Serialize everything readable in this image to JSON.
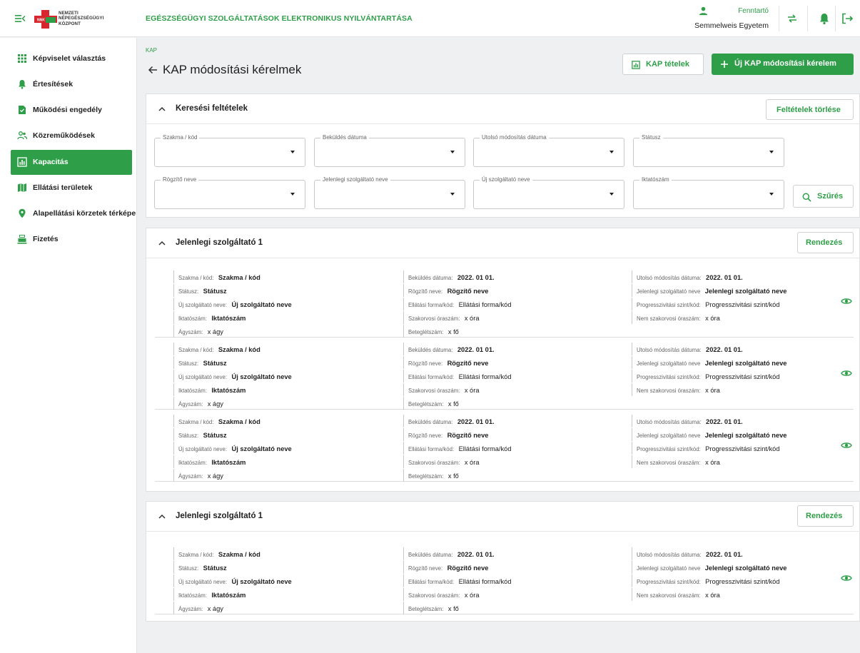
{
  "header": {
    "logo_lines": [
      "NEMZETI",
      "NÉPEGÉSZSÉGÜGYI",
      "KÖZPONT"
    ],
    "logo_badge": "NNK",
    "app_title": "EGÉSZSÉGÜGYI SZOLGÁLTATÁSOK ELEKTRONIKUS NYILVÁNTARTÁSA",
    "user_role": "Fenntartó",
    "user_org": "Semmelweis Egyetem",
    "icons": [
      "menu-collapse-icon",
      "swap-icon",
      "bell-icon",
      "logout-icon",
      "person-icon"
    ]
  },
  "sidebar": {
    "items": [
      {
        "label": "Képviselet választás",
        "icon": "grid-icon",
        "active": false
      },
      {
        "label": "Értesítések",
        "icon": "bell-icon",
        "active": false
      },
      {
        "label": "Működési engedély",
        "icon": "check-doc-icon",
        "active": false
      },
      {
        "label": "Közreműködések",
        "icon": "people-icon",
        "active": false
      },
      {
        "label": "Kapacitás",
        "icon": "chart-icon",
        "active": true
      },
      {
        "label": "Ellátási területek",
        "icon": "map-icon",
        "active": false
      },
      {
        "label": "Alapellátási körzetek térképe",
        "icon": "pin-icon",
        "active": false
      },
      {
        "label": "Fizetés",
        "icon": "register-icon",
        "active": false
      }
    ]
  },
  "main": {
    "breadcrumb": "KAP",
    "title": "KAP módosítási kérelmek",
    "btn_items": "KAP tételek",
    "btn_new": "Új KAP módosítási kérelem",
    "accent": "#2e9e48"
  },
  "search": {
    "title": "Keresési feltételek",
    "clear": "Feltételek törlése",
    "filter": "Szűrés",
    "fields": [
      "Szakma / kód",
      "Beküldés dátuma",
      "Utolsó módosítás dátuma",
      "Státusz",
      "Rögzítő neve",
      "Jelenlegi szolgáltató neve",
      "Új szolgáltató neve",
      "Iktatószám"
    ]
  },
  "labels": {
    "col1": [
      "Szakma / kód:",
      "Státusz:",
      "Új szolgáltató neve:",
      "Iktatószám:",
      "Ágyszám:"
    ],
    "col2": [
      "Beküldés dátuma:",
      "Rögzítő neve:",
      "Ellátási forma/kód:",
      "Szakorvosi óraszám:",
      "Beteglétszám:"
    ],
    "col3": [
      "Utolsó módosítás dátuma:",
      "Jelenlegi szolgáltató neve",
      "Progresszivitási szint/kód:",
      "Nem szakorvosi óraszám:"
    ]
  },
  "groups": [
    {
      "title": "Jelenlegi szolgáltató 1",
      "sort": "Rendezés",
      "records": [
        {
          "c1": [
            "Szakma / kód",
            "Státusz",
            "Új szolgáltató neve",
            "Iktatószám",
            "x ágy"
          ],
          "c2": [
            "2022. 01 01.",
            "Rögzítő neve",
            "Ellátási forma/kód",
            "x óra",
            "x fő"
          ],
          "c3": [
            "2022. 01 01.",
            "Jelenlegi szolgáltató neve",
            "Progresszivitási szint/kód",
            "x óra"
          ]
        },
        {
          "c1": [
            "Szakma / kód",
            "Státusz",
            "Új szolgáltató neve",
            "Iktatószám",
            "x ágy"
          ],
          "c2": [
            "2022. 01 01.",
            "Rögzítő neve",
            "Ellátási forma/kód",
            "x óra",
            "x fő"
          ],
          "c3": [
            "2022. 01 01.",
            "Jelenlegi szolgáltató neve",
            "Progresszivitási szint/kód",
            "x óra"
          ]
        },
        {
          "c1": [
            "Szakma / kód",
            "Státusz",
            "Új szolgáltató neve",
            "Iktatószám",
            "x ágy"
          ],
          "c2": [
            "2022. 01 01.",
            "Rögzítő neve",
            "Ellátási forma/kód",
            "x óra",
            "x fő"
          ],
          "c3": [
            "2022. 01 01.",
            "Jelenlegi szolgáltató neve",
            "Progresszivitási szint/kód",
            "x óra"
          ]
        }
      ]
    },
    {
      "title": "Jelenlegi szolgáltató 1",
      "sort": "Rendezés",
      "records": [
        {
          "c1": [
            "Szakma / kód",
            "Státusz",
            "Új szolgáltató neve",
            "Iktatószám",
            "x ágy"
          ],
          "c2": [
            "2022. 01 01.",
            "Rögzítő neve",
            "Ellátási forma/kód",
            "x óra",
            "x fő"
          ],
          "c3": [
            "2022. 01 01.",
            "Jelenlegi szolgáltató neve",
            "Progresszivitási szint/kód",
            "x óra"
          ]
        }
      ]
    }
  ]
}
